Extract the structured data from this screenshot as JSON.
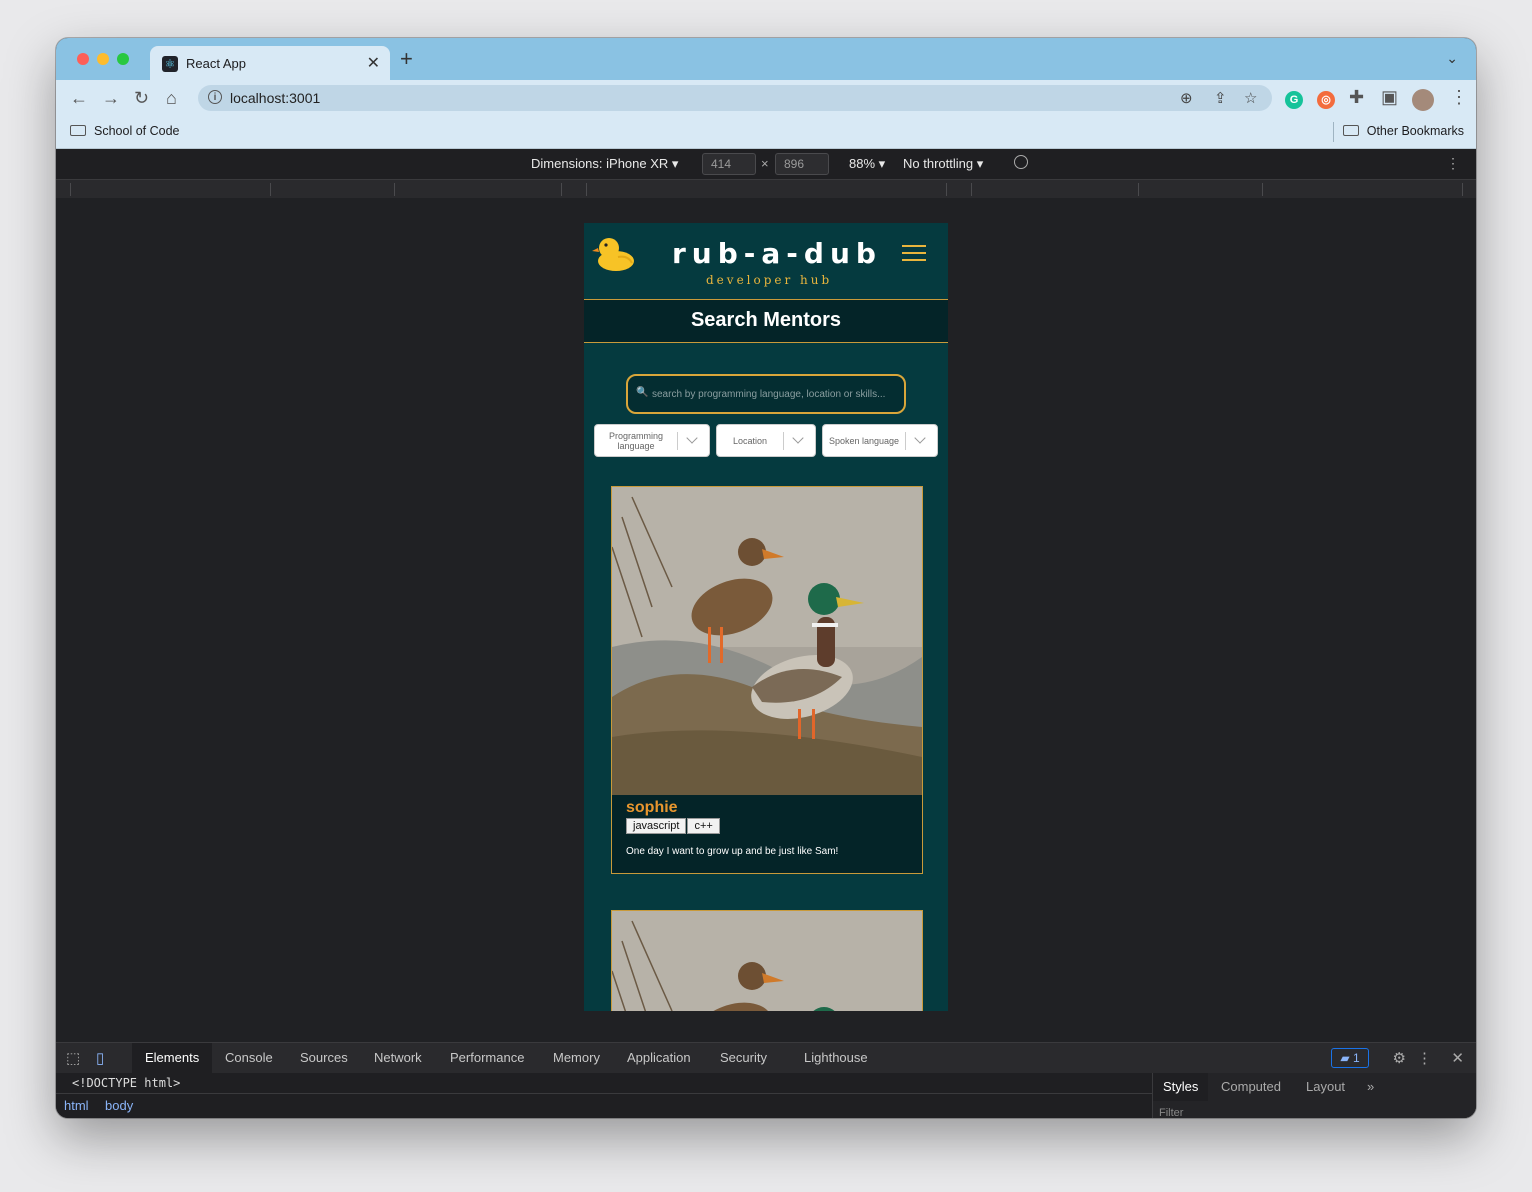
{
  "browser": {
    "tab_title": "React App",
    "url": "localhost:3001",
    "bookmarks": [
      "School of Code"
    ],
    "other_bookmarks": "Other Bookmarks"
  },
  "device_toolbar": {
    "dimensions_label": "Dimensions: iPhone XR",
    "width": "414",
    "times": "×",
    "height": "896",
    "zoom": "88%",
    "throttling": "No throttling"
  },
  "app": {
    "brand": "rub-a-dub",
    "tagline": "developer hub",
    "page_title": "Search Mentors",
    "search_placeholder": "search by programming language, location or skills...",
    "filters": [
      {
        "label": "Programming language"
      },
      {
        "label": "Location"
      },
      {
        "label": "Spoken language"
      }
    ],
    "mentors": [
      {
        "name": "sophie",
        "tags": [
          "javascript",
          "c++"
        ],
        "bio": "One day I want to grow up and be just like Sam!"
      }
    ]
  },
  "devtools": {
    "tabs": [
      "Elements",
      "Console",
      "Sources",
      "Network",
      "Performance",
      "Memory",
      "Application",
      "Security",
      "Lighthouse"
    ],
    "active_tab": "Elements",
    "issues_count": "1",
    "doctype": "<!DOCTYPE html>",
    "breadcrumbs": [
      "html",
      "body"
    ],
    "styles_tabs": [
      "Styles",
      "Computed",
      "Layout"
    ],
    "more_tabs": "»",
    "filter_placeholder": "Filter"
  },
  "colors": {
    "app_bg": "#053a3f",
    "accent_gold": "#e9b53d",
    "mentor_name": "#e8962e",
    "devtools_bg": "#1f1f22",
    "tabbar": "#8ac2e3"
  }
}
